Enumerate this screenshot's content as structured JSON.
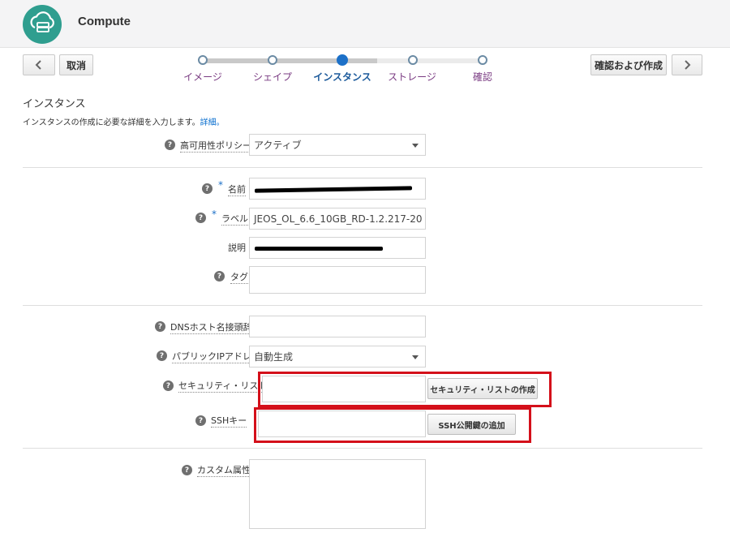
{
  "header": {
    "app_title": "Compute",
    "logo_icon": "cloud-server-icon",
    "logo_color": "#2f9e8f"
  },
  "nav": {
    "cancel_label": "取消",
    "review_create_label": "確認および作成",
    "back_icon": "chevron-left-icon",
    "next_icon": "chevron-right-icon"
  },
  "train": {
    "steps": [
      {
        "label": "イメージ",
        "state": "visited"
      },
      {
        "label": "シェイプ",
        "state": "visited"
      },
      {
        "label": "インスタンス",
        "state": "current"
      },
      {
        "label": "ストレージ",
        "state": "unvisited"
      },
      {
        "label": "確認",
        "state": "unvisited"
      }
    ],
    "current_color": "#1c70c8",
    "visited_label_color": "#7a3b82"
  },
  "section": {
    "title": "インスタンス",
    "description": "インスタンスの作成に必要な詳細を入力します。",
    "details_link": "詳細。"
  },
  "form": {
    "ha_policy": {
      "label": "高可用性ポリシー",
      "value": "アクティブ"
    },
    "name": {
      "label": "名前",
      "required": "*",
      "value_redacted": true
    },
    "label": {
      "label": "ラベル",
      "required": "*",
      "value": "JEOS_OL_6.6_10GB_RD-1.2.217-20"
    },
    "description": {
      "label": "説明",
      "value_redacted": true
    },
    "tags": {
      "label": "タグ",
      "value": ""
    },
    "dns_hostname": {
      "label": "DNSホスト名接頭辞",
      "value": ""
    },
    "public_ip": {
      "label": "パブリックIPアドレス",
      "value": "自動生成"
    },
    "security_list": {
      "label": "セキュリティ・リスト",
      "value": "",
      "button": "セキュリティ・リストの作成"
    },
    "ssh_key": {
      "label": "SSHキー",
      "value": "",
      "button": "SSH公開鍵の追加"
    },
    "custom_attributes": {
      "label": "カスタム属性",
      "value": ""
    },
    "help_glyph": "?"
  },
  "highlight_color": "#d4101a"
}
